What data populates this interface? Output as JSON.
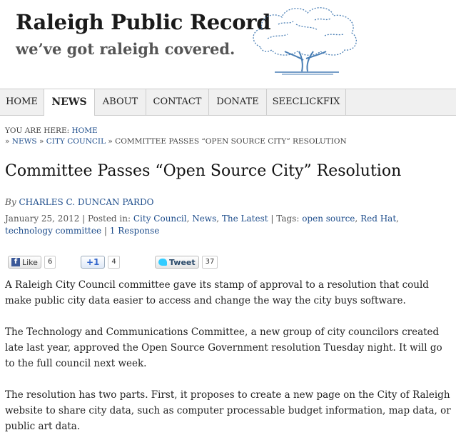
{
  "site": {
    "title": "Raleigh Public Record",
    "tagline": "we’ve got raleigh covered."
  },
  "nav": {
    "items": [
      {
        "label": "HOME"
      },
      {
        "label": "NEWS"
      },
      {
        "label": "ABOUT"
      },
      {
        "label": "CONTACT"
      },
      {
        "label": "DONATE"
      },
      {
        "label": "SEECLICKFIX"
      }
    ],
    "active": "NEWS"
  },
  "breadcrumb": {
    "prefix": "YOU ARE HERE:",
    "home": "HOME",
    "news": "NEWS",
    "city_council": "CITY COUNCIL",
    "current": "COMMITTEE PASSES “OPEN SOURCE CITY” RESOLUTION",
    "separator": "»"
  },
  "article": {
    "title": "Committee Passes “Open Source City” Resolution",
    "by_label": "By",
    "author": "CHARLES C. DUNCAN PARDO",
    "date": "January 25, 2012",
    "posted_in_label": "| Posted in:",
    "categories": [
      "City Council",
      "News",
      "The Latest"
    ],
    "tags_label": "| Tags:",
    "tags": [
      "open source",
      "Red Hat",
      "technology committee"
    ],
    "responses": "1 Response",
    "paragraphs": [
      "A Raleigh City Council committee gave its stamp of approval to a resolution that could make public city data easier to access and change the way the city buys software.",
      "The Technology and Communications Committee, a new group of city councilors created late last year, approved the Open Source Government resolution Tuesday night. It will go to the full council next week.",
      "The resolution has two parts. First, it proposes to create a new page on the City of Raleigh website to share city data, such as computer processable budget information, map data, or public art data."
    ]
  },
  "share": {
    "like_label": "Like",
    "like_count": "6",
    "plus_label": "+1",
    "plus_count": "4",
    "tweet_label": "Tweet",
    "tweet_count": "37"
  },
  "colors": {
    "link": "#1f4e8c",
    "nav_bg": "#f0f0f0",
    "logo_tree": "#4a7fb5"
  }
}
